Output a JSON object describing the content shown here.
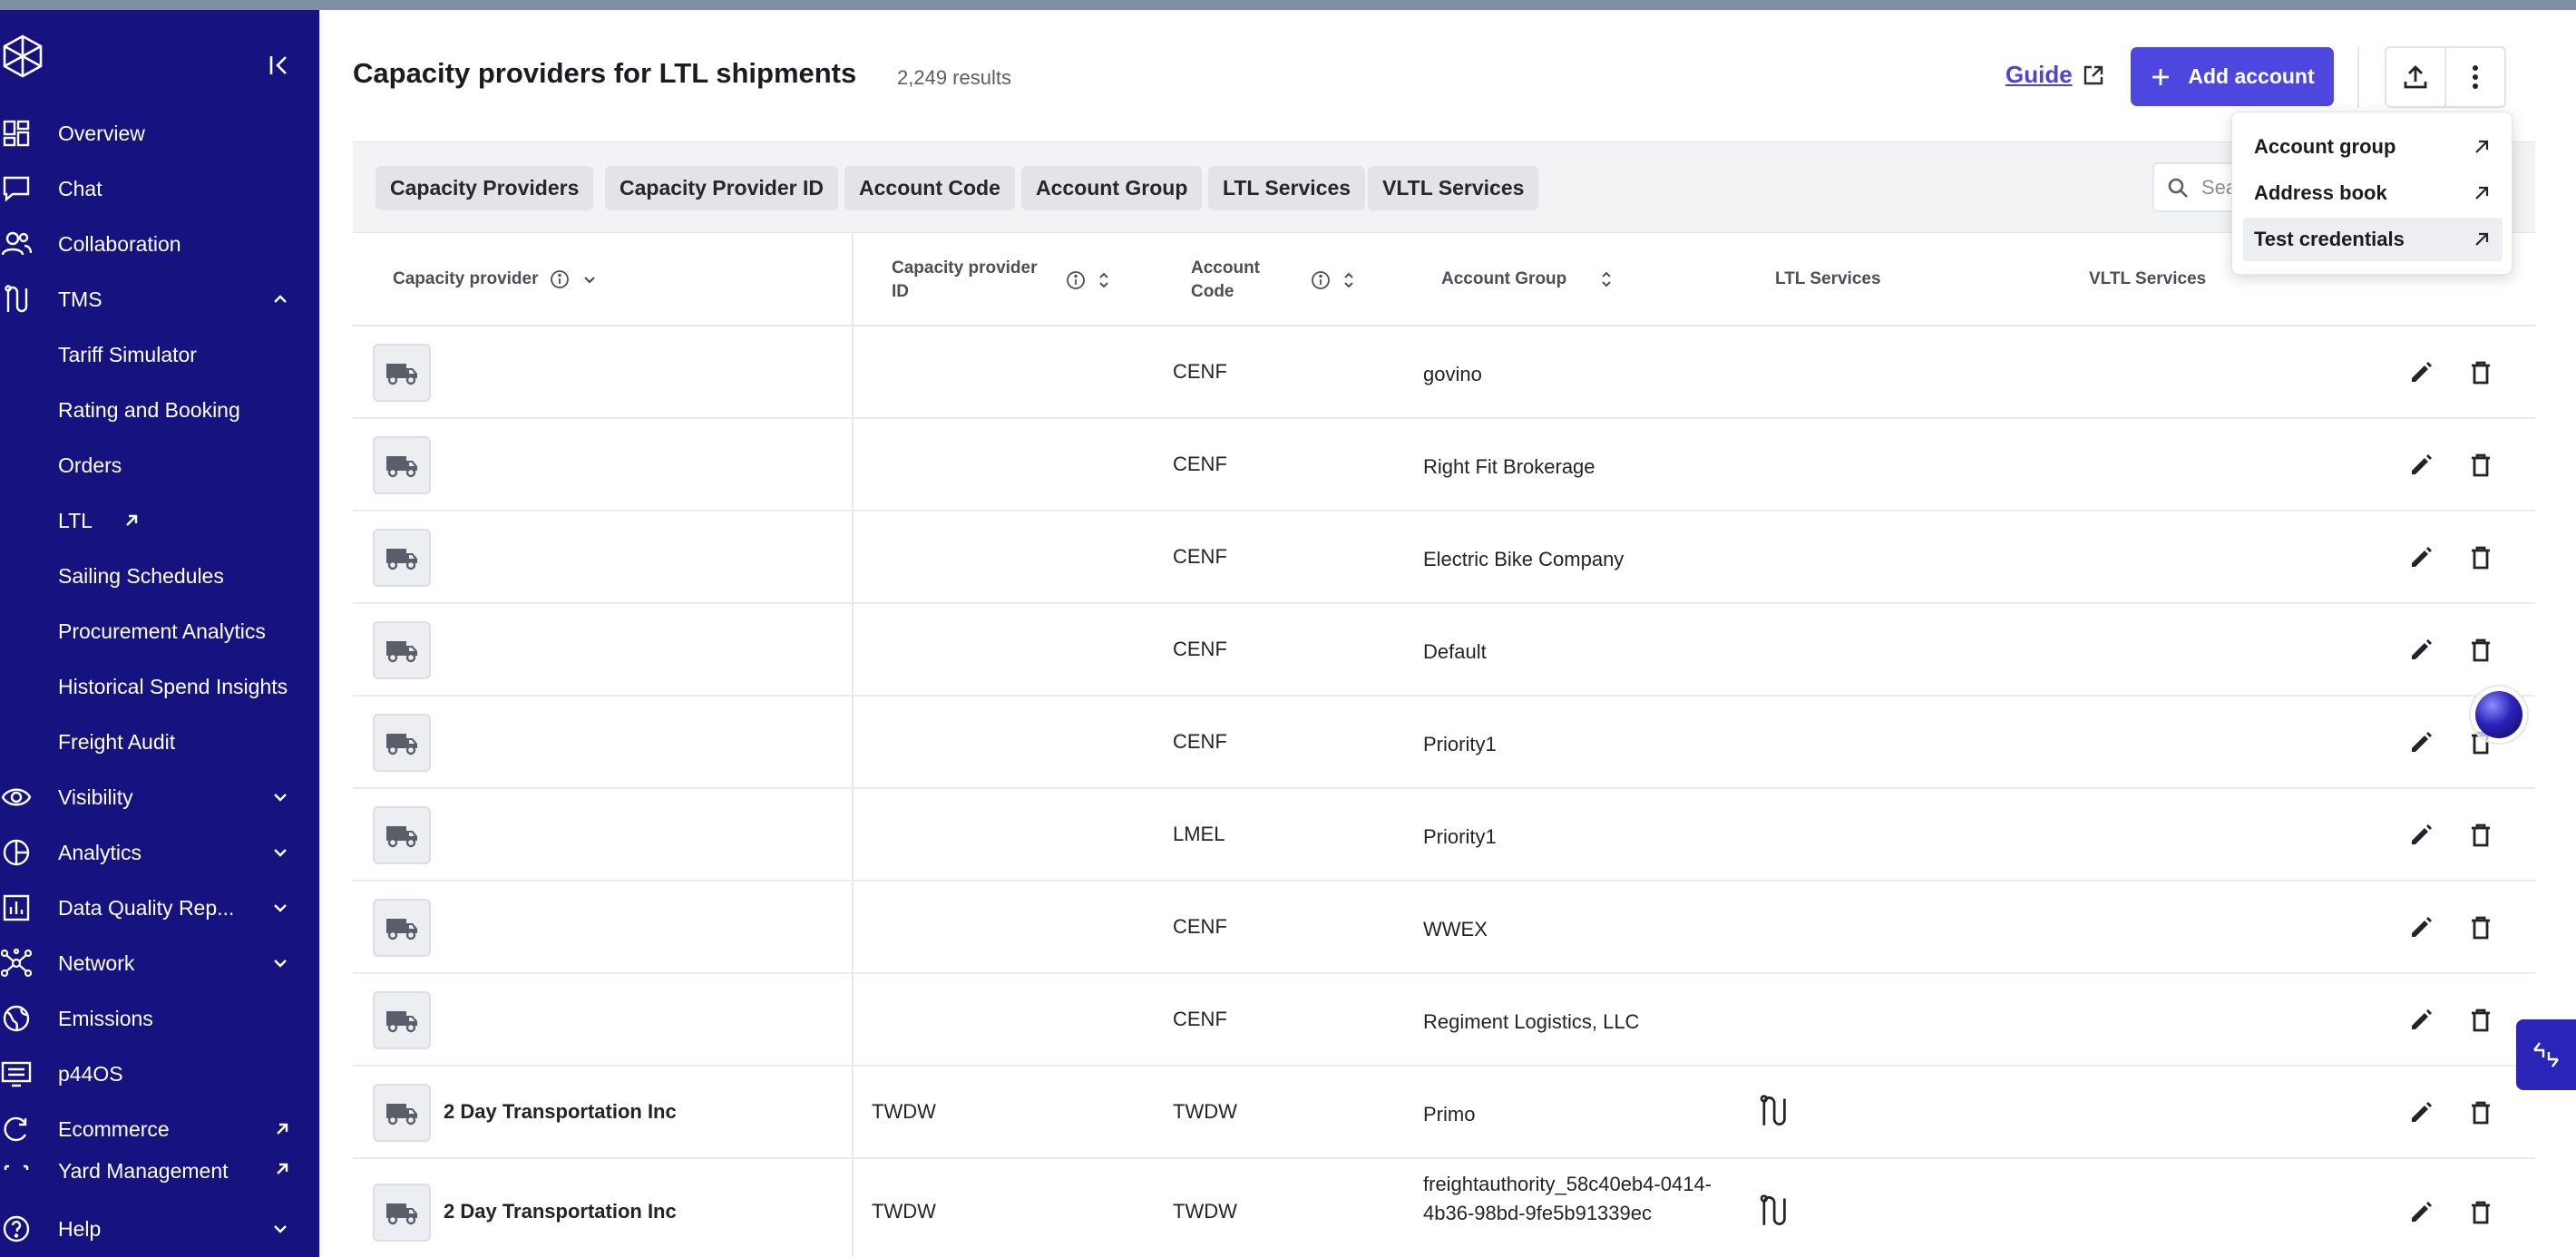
{
  "app": {
    "accent_color": "#4d47e0",
    "sidebar_color": "#161380"
  },
  "sidebar": {
    "items": [
      {
        "label": "Overview",
        "icon": "grid-icon"
      },
      {
        "label": "Chat",
        "icon": "chat-icon"
      },
      {
        "label": "Collaboration",
        "icon": "users-icon"
      },
      {
        "label": "TMS",
        "icon": "route-icon",
        "expanded": true
      },
      {
        "label": "Tariff Simulator"
      },
      {
        "label": "Rating and Booking"
      },
      {
        "label": "Orders"
      },
      {
        "label": "LTL",
        "external": true
      },
      {
        "label": "Sailing Schedules"
      },
      {
        "label": "Procurement Analytics"
      },
      {
        "label": "Historical Spend Insights"
      },
      {
        "label": "Freight Audit"
      },
      {
        "label": "Visibility",
        "icon": "eye-icon"
      },
      {
        "label": "Analytics",
        "icon": "pie-icon"
      },
      {
        "label": "Data Quality Rep...",
        "icon": "bar-chart-icon"
      },
      {
        "label": "Network",
        "icon": "network-icon"
      },
      {
        "label": "Emissions",
        "icon": "globe-icon"
      },
      {
        "label": "p44OS",
        "icon": "monitor-icon"
      },
      {
        "label": "Ecommerce",
        "icon": "ecommerce-icon",
        "external": true
      },
      {
        "label": "Yard Management",
        "icon": "yard-icon",
        "external": true
      },
      {
        "label": "Help",
        "icon": "help-icon"
      }
    ]
  },
  "header": {
    "title": "Capacity providers for LTL shipments",
    "count": "2,249 results",
    "guide": "Guide",
    "add_account": "Add account"
  },
  "filters": {
    "chips": [
      "Capacity Providers",
      "Capacity Provider ID",
      "Account Code",
      "Account Group",
      "LTL Services",
      "VLTL Services"
    ],
    "search_placeholder": "Search"
  },
  "table": {
    "columns": [
      "Capacity provider",
      "Capacity provider ID",
      "Account Code",
      "Account Group",
      "LTL Services",
      "VLTL Services"
    ],
    "rows": [
      {
        "provider": "",
        "provider_id": "",
        "code": "CENF",
        "group": "govino",
        "ltl": false
      },
      {
        "provider": "",
        "provider_id": "",
        "code": "CENF",
        "group": "Right Fit Brokerage",
        "ltl": false
      },
      {
        "provider": "",
        "provider_id": "",
        "code": "CENF",
        "group": "Electric Bike Company",
        "ltl": false
      },
      {
        "provider": "",
        "provider_id": "",
        "code": "CENF",
        "group": "Default",
        "ltl": false
      },
      {
        "provider": "",
        "provider_id": "",
        "code": "CENF",
        "group": "Priority1",
        "ltl": false
      },
      {
        "provider": "",
        "provider_id": "",
        "code": "LMEL",
        "group": "Priority1",
        "ltl": false
      },
      {
        "provider": "",
        "provider_id": "",
        "code": "CENF",
        "group": "WWEX",
        "ltl": false
      },
      {
        "provider": "",
        "provider_id": "",
        "code": "CENF",
        "group": "Regiment Logistics, LLC",
        "ltl": false
      },
      {
        "provider": "2 Day Transportation Inc",
        "provider_id": "TWDW",
        "code": "TWDW",
        "group": "Primo",
        "ltl": true
      },
      {
        "provider": "2 Day Transportation Inc",
        "provider_id": "TWDW",
        "code": "TWDW",
        "group": "freightauthority_58c40eb4-0414-4b36-98bd-9fe5b91339ec",
        "ltl": true
      }
    ]
  },
  "menu": {
    "items": [
      {
        "label": "Account group"
      },
      {
        "label": "Address book"
      },
      {
        "label": "Test credentials",
        "active": true
      }
    ]
  }
}
